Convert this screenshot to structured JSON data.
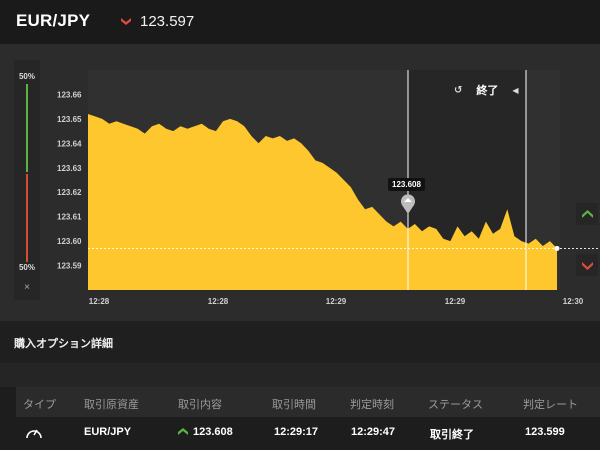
{
  "header": {
    "pair": "EUR/JPY",
    "price": "123.597",
    "trend_icon": "down-chevron-icon",
    "trend_color": "#e04b3a"
  },
  "sidebar_gauge": {
    "top_pct": "50%",
    "bottom_pct": "50%",
    "close_glyph": "×",
    "up_color": "#5cb343",
    "down_color": "#d94b37"
  },
  "chart": {
    "end_label": "終了",
    "marker_value": "123.608",
    "area_color": "#ffc72e",
    "current_price_line": 123.597
  },
  "chart_data": {
    "type": "area",
    "title": "",
    "xlabel": "",
    "ylabel": "",
    "ylim": [
      123.58,
      123.67
    ],
    "yticks": [
      123.66,
      123.65,
      123.64,
      123.63,
      123.62,
      123.61,
      123.6,
      123.59
    ],
    "ytick_labels": [
      "123.66",
      "123.65",
      "123.64",
      "123.63",
      "123.62",
      "123.61",
      "123.60",
      "123.59"
    ],
    "xtick_labels": [
      "12:28",
      "12:28",
      "12:29",
      "12:29",
      "12:30"
    ],
    "series": [
      {
        "values": [
          123.652,
          123.651,
          123.65,
          123.648,
          123.649,
          123.648,
          123.647,
          123.646,
          123.644,
          123.647,
          123.648,
          123.646,
          123.645,
          123.647,
          123.646,
          123.647,
          123.648,
          123.646,
          123.645,
          123.649,
          123.65,
          123.649,
          123.647,
          123.643,
          123.64,
          123.643,
          123.642,
          123.643,
          123.641,
          123.642,
          123.64,
          123.637,
          123.633,
          123.632,
          123.63,
          123.628,
          123.625,
          123.622,
          123.617,
          123.613,
          123.614,
          123.611,
          123.608,
          123.606,
          123.608,
          123.605,
          123.607,
          123.604,
          123.606,
          123.605,
          123.601,
          123.6,
          123.606,
          123.602,
          123.604,
          123.601,
          123.608,
          123.603,
          123.605,
          123.613,
          123.602,
          123.6,
          123.599,
          123.601,
          123.598,
          123.6,
          123.597
        ]
      }
    ]
  },
  "section": {
    "title": "購入オプション詳細"
  },
  "table": {
    "headers": [
      "タイプ",
      "取引原資産",
      "取引内容",
      "取引時間",
      "判定時刻",
      "ステータス",
      "判定レート"
    ],
    "row": {
      "type_icon": "gauge-icon",
      "asset": "EUR/JPY",
      "direction_icon": "up-chevron-icon",
      "content": "123.608",
      "trade_time": "12:29:17",
      "judge_time": "12:29:47",
      "status": "取引終了",
      "rate": "123.599"
    }
  }
}
